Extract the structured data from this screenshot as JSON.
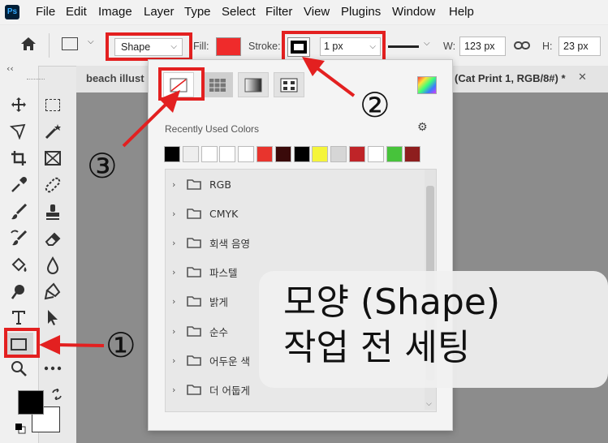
{
  "app": {
    "logo": "Ps"
  },
  "menu": [
    "File",
    "Edit",
    "Image",
    "Layer",
    "Type",
    "Select",
    "Filter",
    "View",
    "Plugins",
    "Window",
    "Help"
  ],
  "options": {
    "mode_value": "Shape",
    "fill_label": "Fill:",
    "stroke_label": "Stroke:",
    "stroke_width": "1 px",
    "width_label": "W:",
    "width_value": "123 px",
    "height_label": "H:",
    "height_value": "23 px",
    "fill_color": "#ef2b2b"
  },
  "tabs": {
    "left_title": "beach illust",
    "right_title": "(Cat Print 1, RGB/8#) *",
    "close_glyph": "✕"
  },
  "panel": {
    "recent_label": "Recently Used Colors",
    "recent_colors": [
      "#000000",
      "#eeeeee",
      "#ffffff",
      "#ffffff",
      "#ffffff",
      "#e8342d",
      "#3a0a0a",
      "#000000",
      "#f5f53a",
      "#d6d6d6",
      "#bf2428",
      "#ffffff",
      "#47c33b",
      "#8e1e1e"
    ],
    "folders": [
      "RGB",
      "CMYK",
      "회색 음영",
      "파스텔",
      "밝게",
      "순수",
      "어두운 색",
      "더 어둡게"
    ]
  },
  "annotations": {
    "marker_1": "①",
    "marker_2": "②",
    "marker_3": "③",
    "overlay_line1": "모양 (Shape)",
    "overlay_line2": "작업 전 세팅",
    "accent_color": "#e32020"
  },
  "toolbar": {
    "collapse_glyph": "‹‹"
  }
}
